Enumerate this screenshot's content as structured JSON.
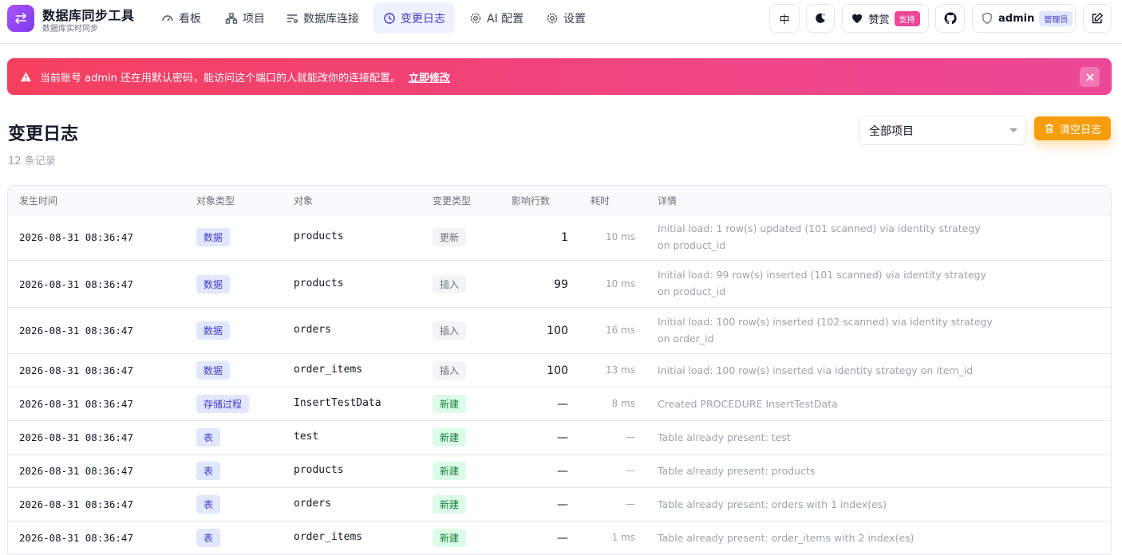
{
  "brand": {
    "title": "数据库同步工具",
    "subtitle": "数据库实时同步"
  },
  "nav": [
    {
      "label": "看板"
    },
    {
      "label": "项目"
    },
    {
      "label": "数据库连接"
    },
    {
      "label": "变更日志"
    },
    {
      "label": "AI 配置"
    },
    {
      "label": "设置"
    }
  ],
  "header": {
    "lang": "中",
    "donate_label": "赞赏",
    "donate_badge": "支持",
    "user": "admin",
    "role_badge": "管理员"
  },
  "alert": {
    "message": "当前账号 admin 还在用默认密码，能访问这个端口的人就能改你的连接配置。",
    "link": "立即修改"
  },
  "page": {
    "title": "变更日志",
    "count": "12 条记录",
    "filter_value": "全部项目",
    "clear_label": "清空日志"
  },
  "table": {
    "headers": [
      "发生时间",
      "对象类型",
      "对象",
      "变更类型",
      "影响行数",
      "耗时",
      "详情"
    ],
    "rows": [
      {
        "time": "2026-08-31 08:36:47",
        "type": "数据",
        "object": "products",
        "change": "更新",
        "rows": "1",
        "duration": "10 ms",
        "detail": "Initial load: 1 row(s) updated (101 scanned) via identity strategy on product_id"
      },
      {
        "time": "2026-08-31 08:36:47",
        "type": "数据",
        "object": "products",
        "change": "插入",
        "rows": "99",
        "duration": "10 ms",
        "detail": "Initial load: 99 row(s) inserted (101 scanned) via identity strategy on product_id"
      },
      {
        "time": "2026-08-31 08:36:47",
        "type": "数据",
        "object": "orders",
        "change": "插入",
        "rows": "100",
        "duration": "16 ms",
        "detail": "Initial load: 100 row(s) inserted (102 scanned) via identity strategy on order_id"
      },
      {
        "time": "2026-08-31 08:36:47",
        "type": "数据",
        "object": "order_items",
        "change": "插入",
        "rows": "100",
        "duration": "13 ms",
        "detail": "Initial load: 100 row(s) inserted via identity strategy on item_id"
      },
      {
        "time": "2026-08-31 08:36:47",
        "type": "存储过程",
        "object": "InsertTestData",
        "change": "新建",
        "rows": "—",
        "duration": "8 ms",
        "detail": "Created PROCEDURE InsertTestData"
      },
      {
        "time": "2026-08-31 08:36:47",
        "type": "表",
        "object": "test",
        "change": "新建",
        "rows": "—",
        "duration": "—",
        "detail": "Table already present: test"
      },
      {
        "time": "2026-08-31 08:36:47",
        "type": "表",
        "object": "products",
        "change": "新建",
        "rows": "—",
        "duration": "—",
        "detail": "Table already present: products"
      },
      {
        "time": "2026-08-31 08:36:47",
        "type": "表",
        "object": "orders",
        "change": "新建",
        "rows": "—",
        "duration": "—",
        "detail": "Table already present: orders with 1 index(es)"
      },
      {
        "time": "2026-08-31 08:36:47",
        "type": "表",
        "object": "order_items",
        "change": "新建",
        "rows": "—",
        "duration": "1 ms",
        "detail": "Table already present: order_items with 2 index(es)"
      }
    ]
  }
}
